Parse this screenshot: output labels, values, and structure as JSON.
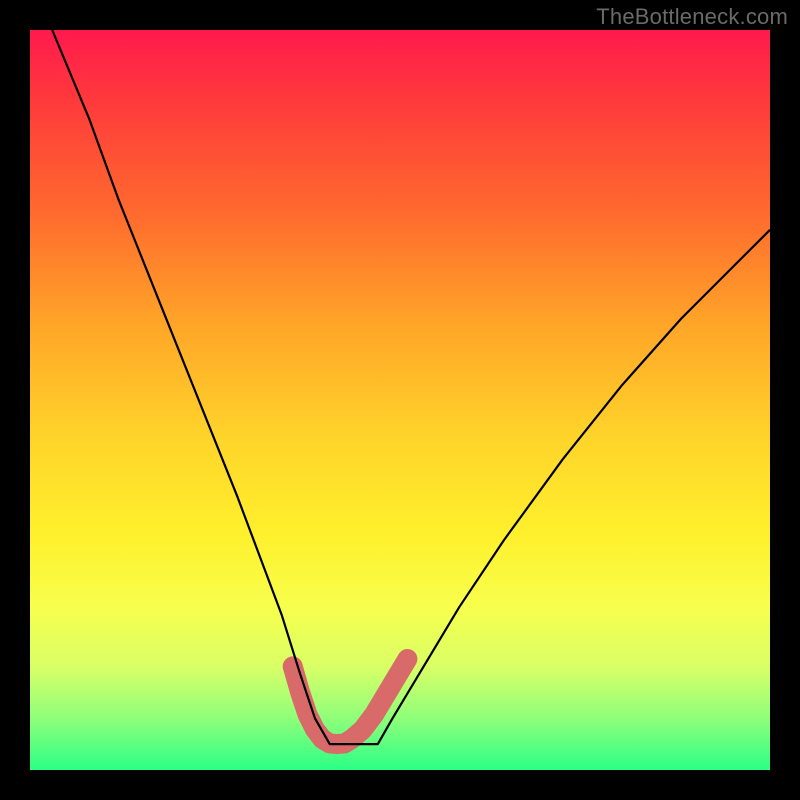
{
  "watermark": "TheBottleneck.com",
  "chart_data": {
    "type": "line",
    "title": "",
    "xlabel": "",
    "ylabel": "",
    "xlim": [
      0,
      100
    ],
    "ylim": [
      0,
      100
    ],
    "series": [
      {
        "name": "bottleneck-curve",
        "x": [
          3,
          8,
          12,
          16,
          20,
          24,
          28,
          31,
          34,
          36.5,
          38.5,
          40.5,
          43,
          47,
          49,
          52,
          58,
          64,
          72,
          80,
          88,
          96,
          100
        ],
        "values": [
          100,
          88,
          77,
          67,
          57,
          47,
          37,
          29,
          21,
          13,
          7,
          3.5,
          3.5,
          3.5,
          7,
          12,
          22,
          31,
          42,
          52,
          61,
          69,
          73
        ]
      }
    ],
    "annotations": [
      {
        "name": "trough-band",
        "color": "#d86a6a",
        "x": [
          35.5,
          36.5,
          37.5,
          38.5,
          39.5,
          40.5,
          41.5,
          42.5,
          43.5,
          45,
          46.5,
          48,
          49.5,
          51
        ],
        "values": [
          14,
          10.5,
          7.5,
          5.5,
          4.2,
          3.6,
          3.5,
          3.6,
          4.2,
          5.5,
          7.5,
          10,
          12.5,
          15
        ]
      }
    ]
  }
}
